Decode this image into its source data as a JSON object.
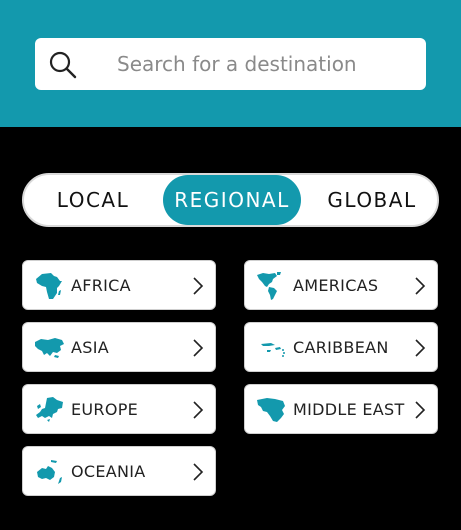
{
  "search": {
    "placeholder": "Search for a destination"
  },
  "tabs": [
    {
      "label": "LOCAL",
      "active": false
    },
    {
      "label": "REGIONAL",
      "active": true
    },
    {
      "label": "GLOBAL",
      "active": false
    }
  ],
  "regions": [
    {
      "label": "AFRICA",
      "icon": "africa-map-icon"
    },
    {
      "label": "AMERICAS",
      "icon": "americas-map-icon"
    },
    {
      "label": "ASIA",
      "icon": "asia-map-icon"
    },
    {
      "label": "CARIBBEAN",
      "icon": "caribbean-map-icon"
    },
    {
      "label": "EUROPE",
      "icon": "europe-map-icon"
    },
    {
      "label": "MIDDLE EAST",
      "icon": "middle-east-map-icon"
    },
    {
      "label": "OCEANIA",
      "icon": "oceania-map-icon"
    }
  ],
  "colors": {
    "accent": "#1399ad",
    "background": "#000000",
    "card": "#ffffff"
  }
}
